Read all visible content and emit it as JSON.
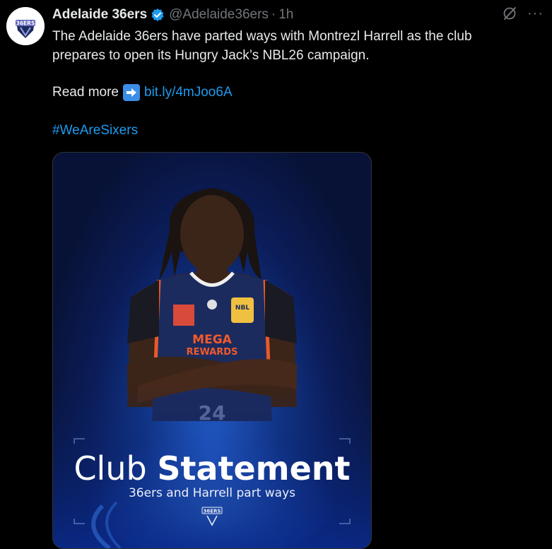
{
  "tweet": {
    "display_name": "Adelaide 36ers",
    "handle": "@Adelaide36ers",
    "separator": "·",
    "time": "1h",
    "text_line1": "The Adelaide 36ers have parted ways with Montrezl Harrell as the club",
    "text_line2": "prepares to open its Hungry Jack’s NBL26 campaign.",
    "read_more": "Read more",
    "link": "bit.ly/4mJoo6A",
    "hashtag": "#WeAreSixers",
    "avatar_text": "36ERS",
    "actions": {
      "grok_icon": "grok-icon",
      "more": "···"
    }
  },
  "media_card": {
    "title_light": "Club",
    "title_bold": "Statement",
    "subtitle": "36ers and Harrell part ways",
    "logo_text": "36ERS",
    "jersey_sponsor_line1": "MEGA",
    "jersey_sponsor_line2": "REWARDS",
    "jersey_badge": "NBL",
    "jersey_number": "24"
  },
  "colors": {
    "background": "#000000",
    "text": "#e7e9ea",
    "muted": "#71767b",
    "link": "#1d9bf0",
    "verified": "#1d9bf0",
    "card_blue": "#12398f"
  }
}
